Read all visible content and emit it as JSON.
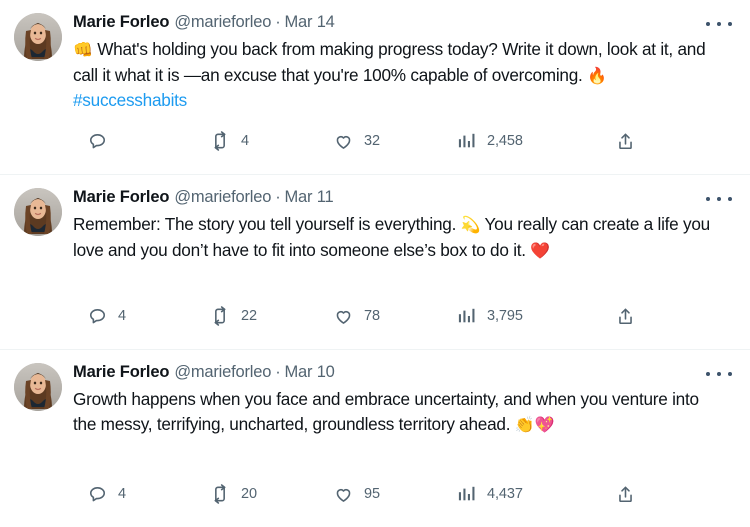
{
  "account": {
    "display_name": "Marie Forleo",
    "handle": "@marieforleo",
    "avatar_alt": "Marie Forleo profile photo"
  },
  "separator": "·",
  "icons": {
    "reply": "reply-icon",
    "retweet": "retweet-icon",
    "like": "heart-icon",
    "views": "analytics-icon",
    "share": "share-icon",
    "more": "more-options-icon"
  },
  "colors": {
    "link": "#1d9bf0",
    "text": "#0f1419",
    "muted": "#536471",
    "divider": "#eff3f4",
    "background": "#ffffff"
  },
  "tweets": [
    {
      "display_name": "Marie Forleo",
      "handle": "@marieforleo",
      "date": "Mar 14",
      "text_line1_emoji": "👊",
      "text_part1": " What's holding you back from making progress today? Write it down, look at it, and call it what it is —an excuse that you're 100% capable of overcoming. ",
      "text_emoji2": "🔥",
      "hashtag": "#successhabits",
      "stats": {
        "replies": "",
        "retweets": "4",
        "likes": "32",
        "views": "2,458"
      }
    },
    {
      "display_name": "Marie Forleo",
      "handle": "@marieforleo",
      "date": "Mar 11",
      "text_part1": "Remember: The story you tell yourself is everything. ",
      "text_emoji1": "💫",
      "text_part2": " You really can create a life you love and you don’t have to fit into someone else’s box to do it. ",
      "text_emoji2": "❤️",
      "stats": {
        "replies": "4",
        "retweets": "22",
        "likes": "78",
        "views": "3,795"
      }
    },
    {
      "display_name": "Marie Forleo",
      "handle": "@marieforleo",
      "date": "Mar 10",
      "text_part1": "Growth happens when you face and embrace uncertainty, and when you venture into the messy, terrifying, uncharted, groundless territory ahead. ",
      "text_emoji1": "👏",
      "text_emoji2": "💖",
      "stats": {
        "replies": "4",
        "retweets": "20",
        "likes": "95",
        "views": "4,437"
      }
    }
  ]
}
